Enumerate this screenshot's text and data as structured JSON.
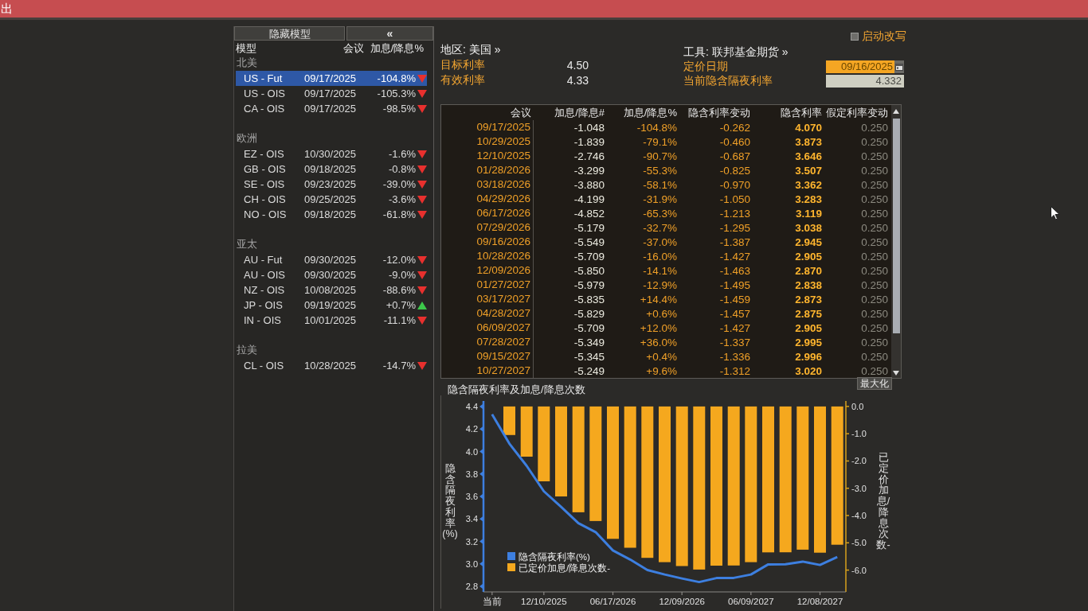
{
  "top_bar": {
    "title": "出"
  },
  "models_panel": {
    "hide_button": "隐藏模型",
    "collapse_button": "«",
    "columns": [
      "模型",
      "会议",
      "加息/降息%"
    ],
    "groups": [
      {
        "name": "北美",
        "rows": [
          {
            "model": "US - Fut",
            "meeting": "09/17/2025",
            "change": "-104.8%",
            "rising": false,
            "selected": true
          },
          {
            "model": "US - OIS",
            "meeting": "09/17/2025",
            "change": "-105.3%",
            "rising": false,
            "selected": false
          },
          {
            "model": "CA - OIS",
            "meeting": "09/17/2025",
            "change": "-98.5%",
            "rising": false,
            "selected": false
          }
        ]
      },
      {
        "name": "欧洲",
        "rows": [
          {
            "model": "EZ - OIS",
            "meeting": "10/30/2025",
            "change": "-1.6%",
            "rising": false,
            "selected": false
          },
          {
            "model": "GB - OIS",
            "meeting": "09/18/2025",
            "change": "-0.8%",
            "rising": false,
            "selected": false
          },
          {
            "model": "SE - OIS",
            "meeting": "09/23/2025",
            "change": "-39.0%",
            "rising": false,
            "selected": false
          },
          {
            "model": "CH - OIS",
            "meeting": "09/25/2025",
            "change": "-3.6%",
            "rising": false,
            "selected": false
          },
          {
            "model": "NO - OIS",
            "meeting": "09/18/2025",
            "change": "-61.8%",
            "rising": false,
            "selected": false
          }
        ]
      },
      {
        "name": "亚太",
        "rows": [
          {
            "model": "AU - Fut",
            "meeting": "09/30/2025",
            "change": "-12.0%",
            "rising": false,
            "selected": false
          },
          {
            "model": "AU - OIS",
            "meeting": "09/30/2025",
            "change": "-9.0%",
            "rising": false,
            "selected": false
          },
          {
            "model": "NZ - OIS",
            "meeting": "10/08/2025",
            "change": "-88.6%",
            "rising": false,
            "selected": false
          },
          {
            "model": "JP - OIS",
            "meeting": "09/19/2025",
            "change": "+0.7%",
            "rising": true,
            "selected": false
          },
          {
            "model": "IN - OIS",
            "meeting": "10/01/2025",
            "change": "-11.1%",
            "rising": false,
            "selected": false
          }
        ]
      },
      {
        "name": "拉美",
        "rows": [
          {
            "model": "CL - OIS",
            "meeting": "10/28/2025",
            "change": "-14.7%",
            "rising": false,
            "selected": false
          }
        ]
      }
    ]
  },
  "summary": {
    "override": {
      "label": "启动改写",
      "checked": false
    },
    "region": "地区: 美国 »",
    "fields": [
      {
        "label": "目标利率",
        "value": "4.50"
      },
      {
        "label": "有效利率",
        "value": "4.33"
      }
    ],
    "instrument": "工具: 联邦基金期货 »",
    "pricing_date": {
      "label": "定价日期",
      "value": "09/16/2025"
    },
    "current_rate": {
      "label": "当前隐含隔夜利率",
      "value": "4.332"
    }
  },
  "table": {
    "columns": [
      "会议",
      "加息/降息#",
      "加息/降息%",
      "隐含利率变动",
      "隐含利率",
      "假定利率变动"
    ],
    "rows": [
      [
        "09/17/2025",
        "-1.048",
        "-104.8%",
        "-0.262",
        "4.070",
        "0.250"
      ],
      [
        "10/29/2025",
        "-1.839",
        "-79.1%",
        "-0.460",
        "3.873",
        "0.250"
      ],
      [
        "12/10/2025",
        "-2.746",
        "-90.7%",
        "-0.687",
        "3.646",
        "0.250"
      ],
      [
        "01/28/2026",
        "-3.299",
        "-55.3%",
        "-0.825",
        "3.507",
        "0.250"
      ],
      [
        "03/18/2026",
        "-3.880",
        "-58.1%",
        "-0.970",
        "3.362",
        "0.250"
      ],
      [
        "04/29/2026",
        "-4.199",
        "-31.9%",
        "-1.050",
        "3.283",
        "0.250"
      ],
      [
        "06/17/2026",
        "-4.852",
        "-65.3%",
        "-1.213",
        "3.119",
        "0.250"
      ],
      [
        "07/29/2026",
        "-5.179",
        "-32.7%",
        "-1.295",
        "3.038",
        "0.250"
      ],
      [
        "09/16/2026",
        "-5.549",
        "-37.0%",
        "-1.387",
        "2.945",
        "0.250"
      ],
      [
        "10/28/2026",
        "-5.709",
        "-16.0%",
        "-1.427",
        "2.905",
        "0.250"
      ],
      [
        "12/09/2026",
        "-5.850",
        "-14.1%",
        "-1.463",
        "2.870",
        "0.250"
      ],
      [
        "01/27/2027",
        "-5.979",
        "-12.9%",
        "-1.495",
        "2.838",
        "0.250"
      ],
      [
        "03/17/2027",
        "-5.835",
        "+14.4%",
        "-1.459",
        "2.873",
        "0.250"
      ],
      [
        "04/28/2027",
        "-5.829",
        "+0.6%",
        "-1.457",
        "2.875",
        "0.250"
      ],
      [
        "06/09/2027",
        "-5.709",
        "+12.0%",
        "-1.427",
        "2.905",
        "0.250"
      ],
      [
        "07/28/2027",
        "-5.349",
        "+36.0%",
        "-1.337",
        "2.995",
        "0.250"
      ],
      [
        "09/15/2027",
        "-5.345",
        "+0.4%",
        "-1.336",
        "2.996",
        "0.250"
      ],
      [
        "10/27/2027",
        "-5.249",
        "+9.6%",
        "-1.312",
        "3.020",
        "0.250"
      ]
    ]
  },
  "chart": {
    "maximize_button": "最大化",
    "chart_data": {
      "type": "bar",
      "title": "隐含隔夜利率及加息/降息次数",
      "ylabel": "隐含隔夜利率(%)",
      "y2label": "已定价加息/降息次数-",
      "categories": [
        "当前",
        null,
        null,
        "12/10/2025",
        null,
        null,
        null,
        "06/17/2026",
        null,
        null,
        null,
        "12/09/2026",
        null,
        null,
        null,
        "06/09/2027",
        null,
        null,
        null,
        "12/08/2027",
        null
      ],
      "ylim": [
        2.75,
        4.45
      ],
      "y2lim": [
        -6.8,
        0.2
      ],
      "yticks": [
        {
          "value": 2.8,
          "label": "2.8"
        },
        {
          "value": 3,
          "label": "3.0"
        },
        {
          "value": 3.2,
          "label": "3.2"
        },
        {
          "value": 3.4,
          "label": "3.4"
        },
        {
          "value": 3.6,
          "label": "3.6"
        },
        {
          "value": 3.8,
          "label": "3.8"
        },
        {
          "value": 4,
          "label": "4.0"
        },
        {
          "value": 4.2,
          "label": "4.2"
        },
        {
          "value": 4.4,
          "label": "4.4"
        }
      ],
      "y2ticks": [
        {
          "value": 0,
          "label": "0.0"
        },
        {
          "value": -1,
          "label": "-1.0"
        },
        {
          "value": -2,
          "label": "-2.0"
        },
        {
          "value": -3,
          "label": "-3.0"
        },
        {
          "value": -4,
          "label": "-4.0"
        },
        {
          "value": -5,
          "label": "-5.0"
        },
        {
          "value": -6,
          "label": "-6.0"
        }
      ],
      "legend": "bottom-left",
      "series": [
        {
          "name": "隐含隔夜利率(%)",
          "type": "line",
          "color": "#3d7fe0",
          "values": [
            4.332,
            4.07,
            3.873,
            3.646,
            3.507,
            3.362,
            3.283,
            3.119,
            3.038,
            2.945,
            2.905,
            2.87,
            2.838,
            2.873,
            2.875,
            2.905,
            2.995,
            2.996,
            3.02,
            2.99,
            3.06
          ]
        },
        {
          "name": "已定价加息/降息次数-",
          "type": "bar",
          "axis": "y2",
          "color": "#f5a81e",
          "values": [
            null,
            -1.048,
            -1.839,
            -2.746,
            -3.299,
            -3.88,
            -4.199,
            -4.852,
            -5.179,
            -5.549,
            -5.709,
            -5.85,
            -5.979,
            -5.835,
            -5.829,
            -5.709,
            -5.349,
            -5.345,
            -5.249,
            -5.36,
            -5.07
          ]
        }
      ]
    }
  }
}
